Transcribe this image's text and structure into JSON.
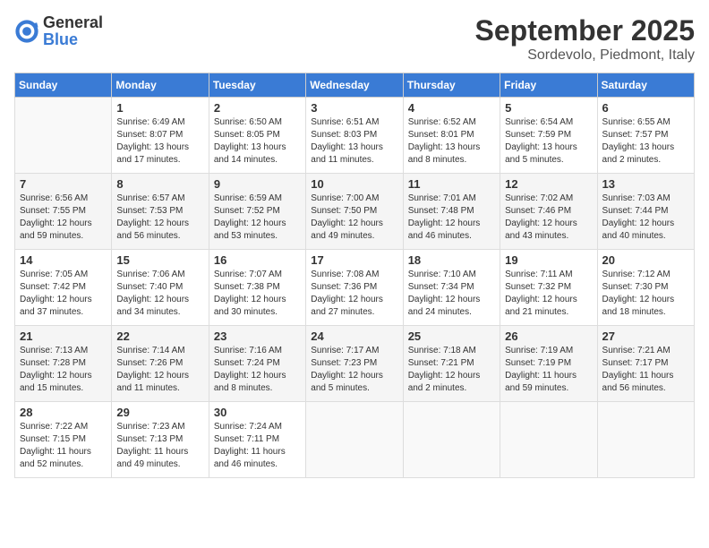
{
  "header": {
    "logo_general": "General",
    "logo_blue": "Blue",
    "month": "September 2025",
    "location": "Sordevolo, Piedmont, Italy"
  },
  "weekdays": [
    "Sunday",
    "Monday",
    "Tuesday",
    "Wednesday",
    "Thursday",
    "Friday",
    "Saturday"
  ],
  "weeks": [
    [
      {
        "day": "",
        "info": ""
      },
      {
        "day": "1",
        "info": "Sunrise: 6:49 AM\nSunset: 8:07 PM\nDaylight: 13 hours\nand 17 minutes."
      },
      {
        "day": "2",
        "info": "Sunrise: 6:50 AM\nSunset: 8:05 PM\nDaylight: 13 hours\nand 14 minutes."
      },
      {
        "day": "3",
        "info": "Sunrise: 6:51 AM\nSunset: 8:03 PM\nDaylight: 13 hours\nand 11 minutes."
      },
      {
        "day": "4",
        "info": "Sunrise: 6:52 AM\nSunset: 8:01 PM\nDaylight: 13 hours\nand 8 minutes."
      },
      {
        "day": "5",
        "info": "Sunrise: 6:54 AM\nSunset: 7:59 PM\nDaylight: 13 hours\nand 5 minutes."
      },
      {
        "day": "6",
        "info": "Sunrise: 6:55 AM\nSunset: 7:57 PM\nDaylight: 13 hours\nand 2 minutes."
      }
    ],
    [
      {
        "day": "7",
        "info": "Sunrise: 6:56 AM\nSunset: 7:55 PM\nDaylight: 12 hours\nand 59 minutes."
      },
      {
        "day": "8",
        "info": "Sunrise: 6:57 AM\nSunset: 7:53 PM\nDaylight: 12 hours\nand 56 minutes."
      },
      {
        "day": "9",
        "info": "Sunrise: 6:59 AM\nSunset: 7:52 PM\nDaylight: 12 hours\nand 53 minutes."
      },
      {
        "day": "10",
        "info": "Sunrise: 7:00 AM\nSunset: 7:50 PM\nDaylight: 12 hours\nand 49 minutes."
      },
      {
        "day": "11",
        "info": "Sunrise: 7:01 AM\nSunset: 7:48 PM\nDaylight: 12 hours\nand 46 minutes."
      },
      {
        "day": "12",
        "info": "Sunrise: 7:02 AM\nSunset: 7:46 PM\nDaylight: 12 hours\nand 43 minutes."
      },
      {
        "day": "13",
        "info": "Sunrise: 7:03 AM\nSunset: 7:44 PM\nDaylight: 12 hours\nand 40 minutes."
      }
    ],
    [
      {
        "day": "14",
        "info": "Sunrise: 7:05 AM\nSunset: 7:42 PM\nDaylight: 12 hours\nand 37 minutes."
      },
      {
        "day": "15",
        "info": "Sunrise: 7:06 AM\nSunset: 7:40 PM\nDaylight: 12 hours\nand 34 minutes."
      },
      {
        "day": "16",
        "info": "Sunrise: 7:07 AM\nSunset: 7:38 PM\nDaylight: 12 hours\nand 30 minutes."
      },
      {
        "day": "17",
        "info": "Sunrise: 7:08 AM\nSunset: 7:36 PM\nDaylight: 12 hours\nand 27 minutes."
      },
      {
        "day": "18",
        "info": "Sunrise: 7:10 AM\nSunset: 7:34 PM\nDaylight: 12 hours\nand 24 minutes."
      },
      {
        "day": "19",
        "info": "Sunrise: 7:11 AM\nSunset: 7:32 PM\nDaylight: 12 hours\nand 21 minutes."
      },
      {
        "day": "20",
        "info": "Sunrise: 7:12 AM\nSunset: 7:30 PM\nDaylight: 12 hours\nand 18 minutes."
      }
    ],
    [
      {
        "day": "21",
        "info": "Sunrise: 7:13 AM\nSunset: 7:28 PM\nDaylight: 12 hours\nand 15 minutes."
      },
      {
        "day": "22",
        "info": "Sunrise: 7:14 AM\nSunset: 7:26 PM\nDaylight: 12 hours\nand 11 minutes."
      },
      {
        "day": "23",
        "info": "Sunrise: 7:16 AM\nSunset: 7:24 PM\nDaylight: 12 hours\nand 8 minutes."
      },
      {
        "day": "24",
        "info": "Sunrise: 7:17 AM\nSunset: 7:23 PM\nDaylight: 12 hours\nand 5 minutes."
      },
      {
        "day": "25",
        "info": "Sunrise: 7:18 AM\nSunset: 7:21 PM\nDaylight: 12 hours\nand 2 minutes."
      },
      {
        "day": "26",
        "info": "Sunrise: 7:19 AM\nSunset: 7:19 PM\nDaylight: 11 hours\nand 59 minutes."
      },
      {
        "day": "27",
        "info": "Sunrise: 7:21 AM\nSunset: 7:17 PM\nDaylight: 11 hours\nand 56 minutes."
      }
    ],
    [
      {
        "day": "28",
        "info": "Sunrise: 7:22 AM\nSunset: 7:15 PM\nDaylight: 11 hours\nand 52 minutes."
      },
      {
        "day": "29",
        "info": "Sunrise: 7:23 AM\nSunset: 7:13 PM\nDaylight: 11 hours\nand 49 minutes."
      },
      {
        "day": "30",
        "info": "Sunrise: 7:24 AM\nSunset: 7:11 PM\nDaylight: 11 hours\nand 46 minutes."
      },
      {
        "day": "",
        "info": ""
      },
      {
        "day": "",
        "info": ""
      },
      {
        "day": "",
        "info": ""
      },
      {
        "day": "",
        "info": ""
      }
    ]
  ]
}
